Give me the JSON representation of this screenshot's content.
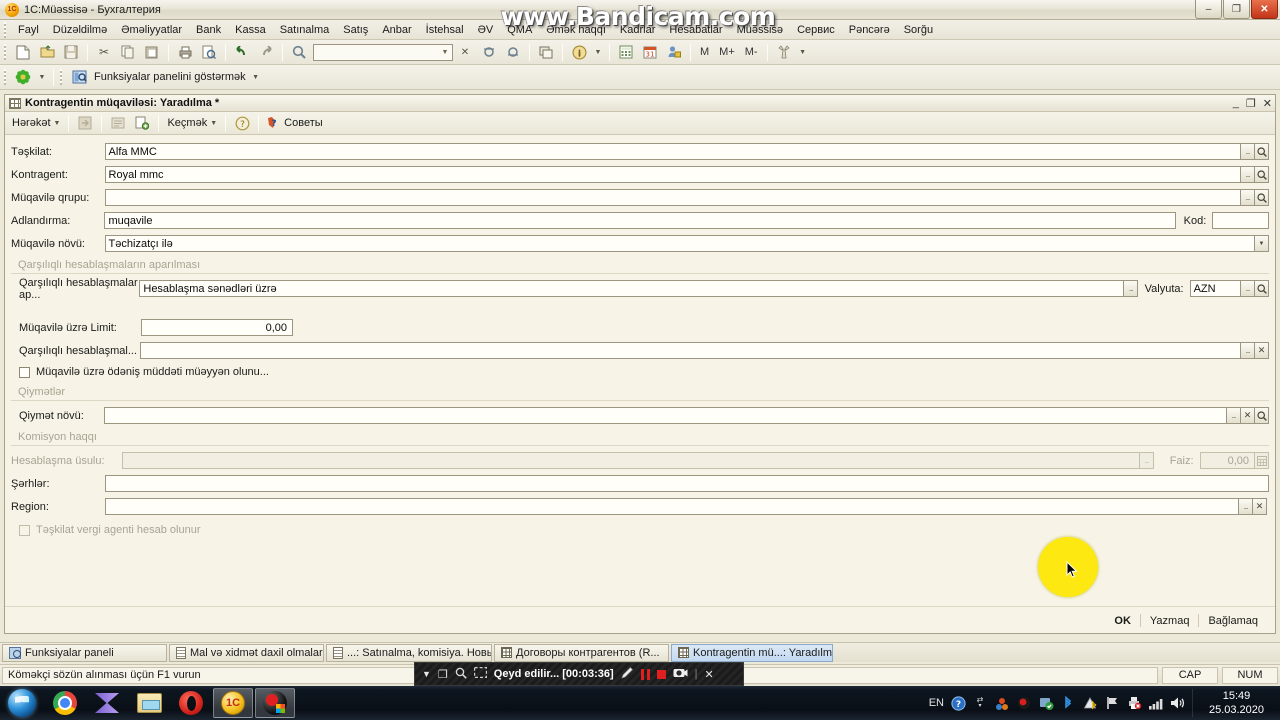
{
  "window": {
    "title": "1C:Müəssisə - Бухгалтерия",
    "app_icon": "onec-icon",
    "minimize": "–",
    "maximize": "❐",
    "close": "✕"
  },
  "menubar": {
    "items": [
      {
        "label": "Fayl"
      },
      {
        "label": "Düzəldilmə"
      },
      {
        "label": "Əməliyyatlar"
      },
      {
        "label": "Bank"
      },
      {
        "label": "Kassa"
      },
      {
        "label": "Satınalma"
      },
      {
        "label": "Satış"
      },
      {
        "label": "Anbar"
      },
      {
        "label": "İstehsal"
      },
      {
        "label": "ƏV"
      },
      {
        "label": "QMA"
      },
      {
        "label": "Əmək haqqı"
      },
      {
        "label": "Kadrlar"
      },
      {
        "label": "Hesabatlar"
      },
      {
        "label": "Müəssisə"
      },
      {
        "label": "Сервис"
      },
      {
        "label": "Pəncərə"
      },
      {
        "label": "Sorğu"
      }
    ]
  },
  "toolbar1": {
    "buttons": [
      {
        "name": "new-icon",
        "glyph": "🗋"
      },
      {
        "name": "open-icon",
        "glyph": "🗁"
      },
      {
        "name": "save-icon",
        "glyph": "🖫"
      },
      {
        "name": "cut-icon",
        "glyph": "✂"
      },
      {
        "name": "copy-icon",
        "glyph": "⎘"
      },
      {
        "name": "paste-icon",
        "glyph": "📋"
      },
      {
        "name": "print-icon",
        "glyph": "🖨"
      },
      {
        "name": "print-preview-icon",
        "glyph": "🔍"
      },
      {
        "name": "undo-icon",
        "glyph": "↩"
      },
      {
        "name": "redo-icon",
        "glyph": "↪"
      },
      {
        "name": "find-icon",
        "glyph": "🔍"
      }
    ],
    "search_value": "",
    "search_dropdown": "▼",
    "clear_icon": "✕",
    "find-next-icon": "🔎",
    "find-prev-icon": "🔎",
    "windows-icon": "❐",
    "info-icon": "i",
    "calculator-icon": "▦",
    "calendar-icon": "31",
    "user-icon": "👤",
    "m_labels": [
      "M",
      "M+",
      "M-"
    ],
    "tools-icon": "🔧"
  },
  "toolbar2": {
    "flower_icon": "✿",
    "panel_icon": "functions-panel-icon",
    "panel_label": "Funksiyalar panelini göstərmək"
  },
  "child_window": {
    "title": "Kontragentin müqaviləsi: Yaradılma *",
    "icon": "grid-icon",
    "minimize": "_",
    "restore": "❐",
    "close": "✕",
    "toolbar": {
      "action_label": "Hərəkət",
      "save-icon": "🖫",
      "write-icon": "🖹",
      "copy-icon": "🗎",
      "goto_label": "Keçmək",
      "help_label": "?",
      "tips_label": "Советы"
    },
    "footer": {
      "ok": "OK",
      "write": "Yazmaq",
      "close": "Bağlamaq"
    }
  },
  "form": {
    "fields": [
      {
        "label": "Təşkilat:",
        "value": "Alfa MMC"
      },
      {
        "label": "Kontragent:",
        "value": "Royal mmc"
      },
      {
        "label": "Müqavilə qrupu:",
        "value": ""
      },
      {
        "label": "Adlandırma:",
        "value": "muqavile"
      },
      {
        "label": "Müqavilə növü:",
        "value": "Təchizatçı ilə"
      }
    ],
    "kod_label": "Kod:",
    "kod_value": "",
    "section1_title": "Qarşılıqlı hesablaşmaların aparılması",
    "settlement_label": "Qarşılıqlı hesablaşmalar ap...",
    "settlement_value": "Hesablaşma sənədləri üzrə",
    "valyuta_label": "Valyuta:",
    "valyuta_value": "AZN",
    "limit_label": "Müqavilə üzrə Limit:",
    "limit_value": "0,00",
    "settlement2_label": "Qarşılıqlı hesablaşmal...",
    "settlement2_value": "",
    "checkbox1_label": "Müqavilə üzrə ödəniş müddəti müəyyən olunu...",
    "section2_title": "Qiymətlər",
    "price_type_label": "Qiymət növü:",
    "price_type_value": "",
    "section3_title": "Komisyon haqqı",
    "calc_method_label": "Hesablaşma üsulu:",
    "calc_method_value": "",
    "faiz_label": "Faiz:",
    "faiz_value": "0,00",
    "comment_label": "Şərhlər:",
    "comment_value": "",
    "region_label": "Region:",
    "region_value": "",
    "checkbox2_label": "Təşkilat vergi agenti hesab olunur"
  },
  "mdi_taskbar": {
    "buttons": [
      {
        "label": "Funksiyalar paneli",
        "icon": "functions-panel-icon",
        "active": false
      },
      {
        "label": "Mal və xidmət daxil olmaları",
        "icon": "document-icon",
        "active": false
      },
      {
        "label": "...: Satınalma, komisiya. Новы...",
        "icon": "document-icon",
        "active": false
      },
      {
        "label": "Договоры контрагентов (R...",
        "icon": "table-icon",
        "active": false
      },
      {
        "label": "Kontragentin mü...: Yaradılma *",
        "icon": "table-icon",
        "active": true
      }
    ]
  },
  "statusbar": {
    "hint": "Köməkçi sözün alınması üçün F1 vurun",
    "cap": "CAP",
    "num": "NUM"
  },
  "watermark": {
    "text": "www.Bandicam.com"
  },
  "bandicam": {
    "dropdown-icon": "▼",
    "window-icon": "❐",
    "zoom-icon": "🔍",
    "region-icon": "⬚",
    "status": "Qeyd edilir... [00:03:36]",
    "draw-icon": "✎",
    "pause-icon": "pause",
    "stop-icon": "stop",
    "camera-icon": "📷",
    "close-icon": "✕"
  },
  "taskbar": {
    "start": "start-orb",
    "items": [
      {
        "name": "chrome-icon",
        "pressed": false
      },
      {
        "name": "media-player-icon",
        "pressed": false
      },
      {
        "name": "explorer-icon",
        "pressed": false
      },
      {
        "name": "opera-icon",
        "pressed": false
      },
      {
        "name": "onec-icon",
        "pressed": true
      },
      {
        "name": "bandicam-icon",
        "pressed": true
      }
    ],
    "tray": {
      "language": "EN",
      "icons": [
        "help-icon",
        "action-center-icon",
        "utorrent-icon",
        "record-icon",
        "antivirus-icon",
        "bluetooth-icon",
        "warning-icon",
        "flag-icon",
        "printer-icon",
        "network-icon",
        "volume-icon"
      ],
      "time": "15:49",
      "date": "25.03.2020"
    }
  }
}
